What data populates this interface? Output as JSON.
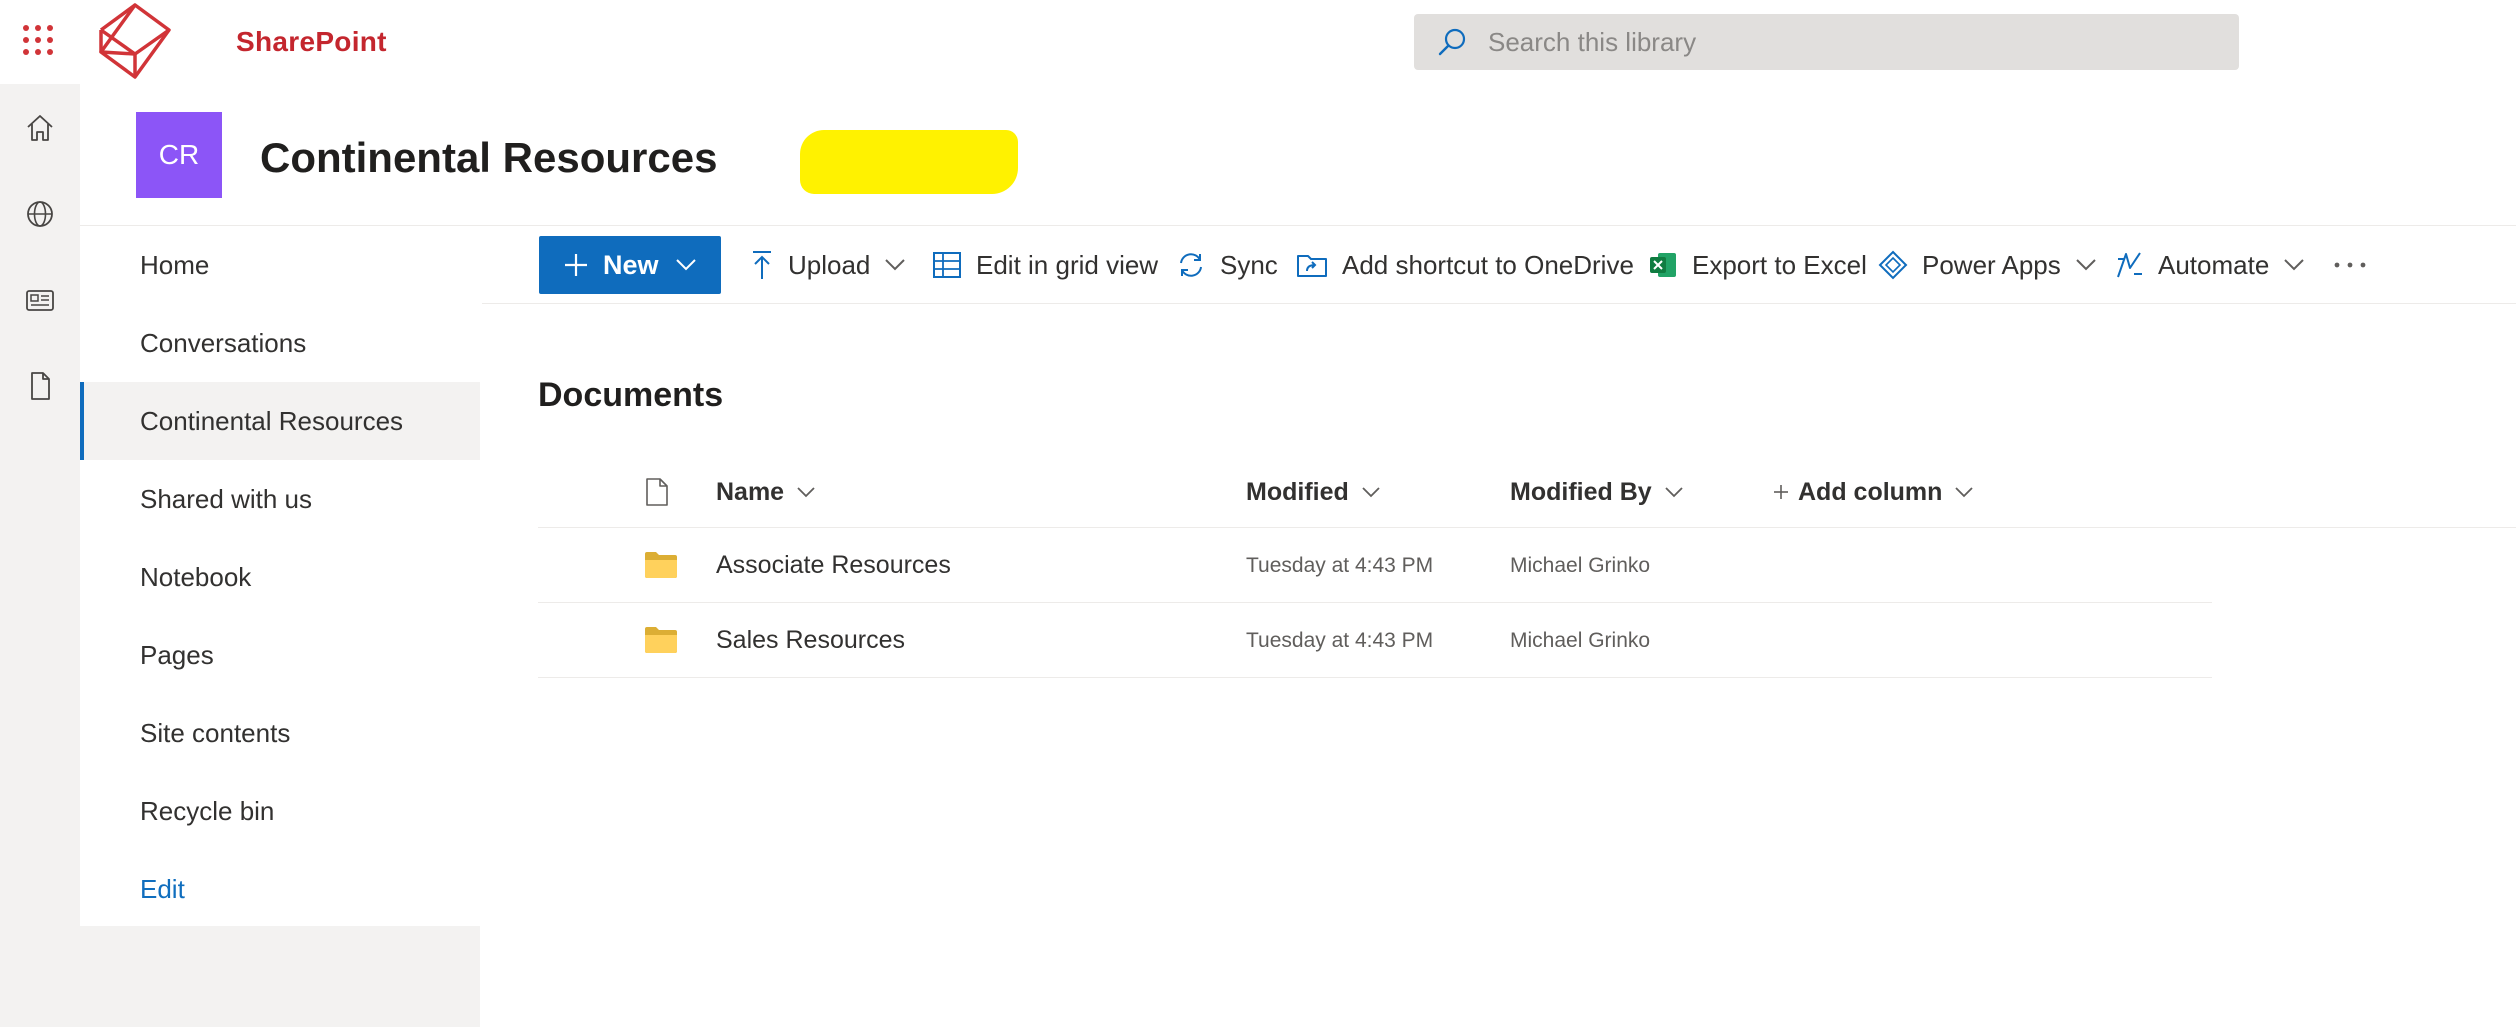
{
  "suite_header": {
    "app_name": "SharePoint",
    "search_placeholder": "Search this library",
    "brand_color": "#c4262e"
  },
  "app_bar": {
    "items": [
      {
        "icon": "home-icon"
      },
      {
        "icon": "globe-icon"
      },
      {
        "icon": "news-icon"
      },
      {
        "icon": "file-icon"
      }
    ]
  },
  "site": {
    "logo_initials": "CR",
    "logo_color": "#8c55f7",
    "title": "Continental Resources"
  },
  "left_nav": {
    "items": [
      {
        "label": "Home"
      },
      {
        "label": "Conversations"
      },
      {
        "label": "Continental Resources",
        "selected": true
      },
      {
        "label": "Shared with us"
      },
      {
        "label": "Notebook"
      },
      {
        "label": "Pages"
      },
      {
        "label": "Site contents"
      },
      {
        "label": "Recycle bin"
      }
    ],
    "edit_label": "Edit"
  },
  "command_bar": {
    "new_label": "New",
    "upload_label": "Upload",
    "edit_grid_label": "Edit in grid view",
    "sync_label": "Sync",
    "add_shortcut_label": "Add shortcut to OneDrive",
    "export_label": "Export to Excel",
    "power_apps_label": "Power Apps",
    "automate_label": "Automate",
    "highlight_color": "#fff200",
    "accent_color": "#0f6cbd"
  },
  "library": {
    "title": "Documents",
    "columns": {
      "name": "Name",
      "modified": "Modified",
      "modified_by": "Modified By",
      "add_column": "Add column"
    },
    "rows": [
      {
        "name": "Associate Resources",
        "modified": "Tuesday at 4:43 PM",
        "modified_by": "Michael Grinko",
        "type": "folder"
      },
      {
        "name": "Sales Resources",
        "modified": "Tuesday at 4:43 PM",
        "modified_by": "Michael Grinko",
        "type": "folder"
      }
    ]
  }
}
